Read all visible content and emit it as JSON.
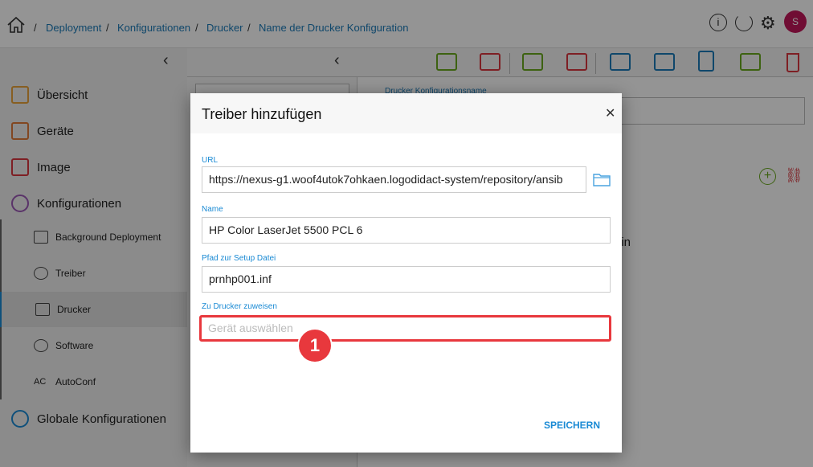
{
  "breadcrumb": [
    "Deployment",
    "Konfigurationen",
    "Drucker",
    "Name der Drucker Konfiguration"
  ],
  "user_initial": "S",
  "sidebar": {
    "items": [
      {
        "label": "Übersicht",
        "icon": "overview-icon",
        "color": "#e8a33a"
      },
      {
        "label": "Geräte",
        "icon": "devices-icon",
        "color": "#e07a3a"
      },
      {
        "label": "Image",
        "icon": "image-icon",
        "color": "#d9363e"
      },
      {
        "label": "Konfigurationen",
        "icon": "config-gear-icon",
        "color": "#9b59b6"
      }
    ],
    "sub_items": [
      {
        "label": "Background Deployment",
        "icon": "background-deployment-icon"
      },
      {
        "label": "Treiber",
        "icon": "driver-disc-icon"
      },
      {
        "label": "Drucker",
        "icon": "printer-icon",
        "active": true
      },
      {
        "label": "Software",
        "icon": "software-disc-icon"
      },
      {
        "label": "AutoConf",
        "icon": "autoconf-icon"
      }
    ],
    "global": {
      "label": "Globale Konfigurationen",
      "icon": "global-config-icon",
      "color": "#1a8ad4"
    }
  },
  "toolbar": [
    {
      "icon": "add-driver-icon",
      "color": "#6aaa1e"
    },
    {
      "icon": "remove-driver-icon",
      "color": "#d9363e"
    },
    {
      "icon": "add-printer-icon",
      "color": "#6aaa1e"
    },
    {
      "icon": "remove-printer-icon",
      "color": "#d9363e"
    },
    {
      "icon": "edit-printer-icon",
      "color": "#1a7ab8"
    },
    {
      "icon": "sync-printer-icon",
      "color": "#1a7ab8"
    },
    {
      "icon": "copy-icon",
      "color": "#1a7ab8"
    },
    {
      "icon": "printer-settings-icon",
      "color": "#6aaa1e"
    },
    {
      "icon": "delete-icon",
      "color": "#d9363e"
    }
  ],
  "background": {
    "config_name_label": "Drucker Konfigurationsname",
    "partial_text": "ein"
  },
  "dialog": {
    "title": "Treiber hinzufügen",
    "url_label": "URL",
    "url_value": "https://nexus-g1.woof4utok7ohkaen.logodidact-system/repository/ansib",
    "name_label": "Name",
    "name_value": "HP Color LaserJet 5500 PCL 6",
    "path_label": "Pfad zur Setup Datei",
    "path_value": "prnhp001.inf",
    "assign_label": "Zu Drucker zuweisen",
    "assign_placeholder": "Gerät auswählen",
    "save_label": "SPEICHERN",
    "annotation": "1",
    "highlight_color": "#e8383d"
  }
}
